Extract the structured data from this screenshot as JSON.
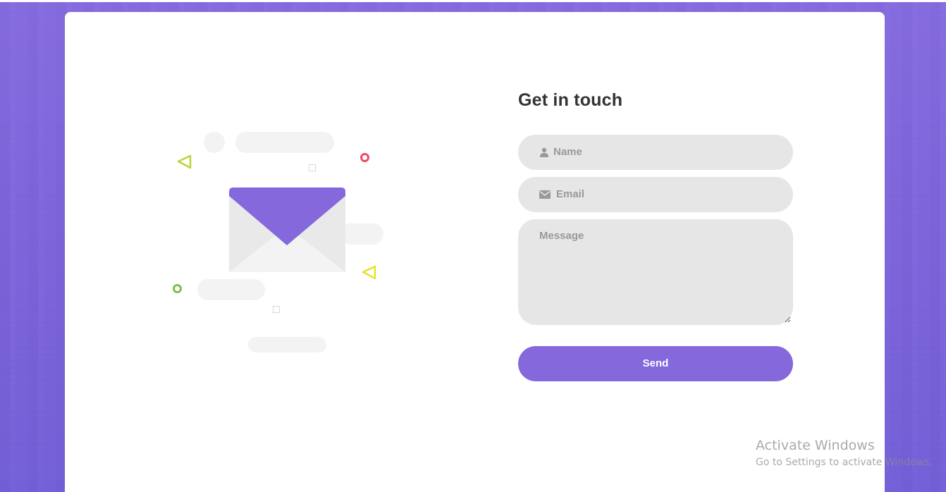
{
  "contact": {
    "title": "Get in touch",
    "name_placeholder": "Name",
    "email_placeholder": "Email",
    "message_placeholder": "Message",
    "send_label": "Send"
  },
  "icons": {
    "name_field": "user-icon",
    "email_field": "envelope-icon",
    "illustration": "envelope-illustration"
  },
  "colors": {
    "accent": "#8468dc",
    "field_bg": "#e6e6e6",
    "placeholder": "#999999",
    "title": "#333333",
    "ring_red": "#ef4a63",
    "ring_green": "#7cc04b",
    "triangle_yellow": "#e6e22a",
    "triangle_lime": "#bcd33a"
  },
  "watermark": {
    "line1": "Activate Windows",
    "line2": "Go to Settings to activate Windows."
  }
}
